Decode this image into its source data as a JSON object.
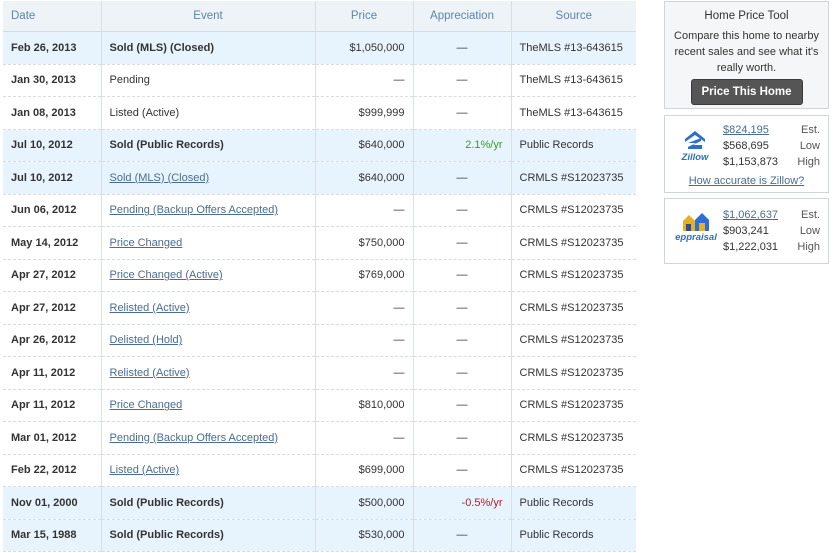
{
  "history": {
    "columns": [
      "Date",
      "Event",
      "Price",
      "Appreciation",
      "Source"
    ],
    "rows": [
      {
        "date": "Feb 26, 2013",
        "event": "Sold (MLS) (Closed)",
        "style": "bold",
        "price": "$1,050,000",
        "appreciation": "—",
        "source": "TheMLS #13-643615",
        "highlight": true
      },
      {
        "date": "Jan 30, 2013",
        "event": "Pending",
        "style": "plain",
        "price": "—",
        "appreciation": "—",
        "source": "TheMLS #13-643615",
        "highlight": false
      },
      {
        "date": "Jan 08, 2013",
        "event": "Listed (Active)",
        "style": "plain",
        "price": "$999,999",
        "appreciation": "—",
        "source": "TheMLS #13-643615",
        "highlight": false
      },
      {
        "date": "Jul 10, 2012",
        "event": "Sold (Public Records)",
        "style": "bold",
        "price": "$640,000",
        "appreciation": "2.1%/yr",
        "trend": "pos",
        "source": "Public Records",
        "highlight": true
      },
      {
        "date": "Jul 10, 2012",
        "event": "Sold (MLS) (Closed)",
        "style": "link",
        "price": "$640,000",
        "appreciation": "—",
        "source": "CRMLS #S12023735",
        "highlight": true
      },
      {
        "date": "Jun 06, 2012",
        "event": "Pending (Backup Offers Accepted)",
        "style": "link",
        "price": "—",
        "appreciation": "—",
        "source": "CRMLS #S12023735",
        "highlight": false
      },
      {
        "date": "May 14, 2012",
        "event": "Price Changed",
        "style": "link",
        "price": "$750,000",
        "appreciation": "—",
        "source": "CRMLS #S12023735",
        "highlight": false
      },
      {
        "date": "Apr 27, 2012",
        "event": "Price Changed (Active)",
        "style": "link",
        "price": "$769,000",
        "appreciation": "—",
        "source": "CRMLS #S12023735",
        "highlight": false
      },
      {
        "date": "Apr 27, 2012",
        "event": "Relisted (Active)",
        "style": "link",
        "price": "—",
        "appreciation": "—",
        "source": "CRMLS #S12023735",
        "highlight": false
      },
      {
        "date": "Apr 26, 2012",
        "event": "Delisted (Hold)",
        "style": "link",
        "price": "—",
        "appreciation": "—",
        "source": "CRMLS #S12023735",
        "highlight": false
      },
      {
        "date": "Apr 11, 2012",
        "event": "Relisted (Active)",
        "style": "link",
        "price": "—",
        "appreciation": "—",
        "source": "CRMLS #S12023735",
        "highlight": false
      },
      {
        "date": "Apr 11, 2012",
        "event": "Price Changed",
        "style": "link",
        "price": "$810,000",
        "appreciation": "—",
        "source": "CRMLS #S12023735",
        "highlight": false
      },
      {
        "date": "Mar 01, 2012",
        "event": "Pending (Backup Offers Accepted)",
        "style": "link",
        "price": "—",
        "appreciation": "—",
        "source": "CRMLS #S12023735",
        "highlight": false
      },
      {
        "date": "Feb 22, 2012",
        "event": "Listed (Active)",
        "style": "link",
        "price": "$699,000",
        "appreciation": "—",
        "source": "CRMLS #S12023735",
        "highlight": false
      },
      {
        "date": "Nov 01, 2000",
        "event": "Sold (Public Records)",
        "style": "bold",
        "price": "$500,000",
        "appreciation": "-0.5%/yr",
        "trend": "neg",
        "source": "Public Records",
        "highlight": true
      },
      {
        "date": "Mar 15, 1988",
        "event": "Sold (Public Records)",
        "style": "bold",
        "price": "$530,000",
        "appreciation": "—",
        "source": "Public Records",
        "highlight": true
      }
    ]
  },
  "tool": {
    "title": "Home Price Tool",
    "description": "Compare this home to nearby recent sales and see what it's really worth.",
    "button": "Price This Home"
  },
  "zillow": {
    "logo_text": "Zillow",
    "icon": "zillow-logo-icon",
    "estimate": "$824,195",
    "estimate_label": "Est.",
    "low": "$568,695",
    "low_label": "Low",
    "high": "$1,153,873",
    "high_label": "High",
    "accuracy_link": "How accurate is Zillow?"
  },
  "eppraisal": {
    "logo_text": "eppraisal",
    "icon": "eppraisal-logo-icon",
    "estimate": "$1,062,637",
    "estimate_label": "Est.",
    "low": "$903,241",
    "low_label": "Low",
    "high": "$1,222,031",
    "high_label": "High"
  },
  "colors": {
    "header_bg": "#eef3f8",
    "header_text": "#5b86ad",
    "highlight_row": "#e8f4fd",
    "link": "#4a6d91",
    "positive": "#3b9a2e",
    "negative": "#b01c2e",
    "button": "#555555"
  }
}
